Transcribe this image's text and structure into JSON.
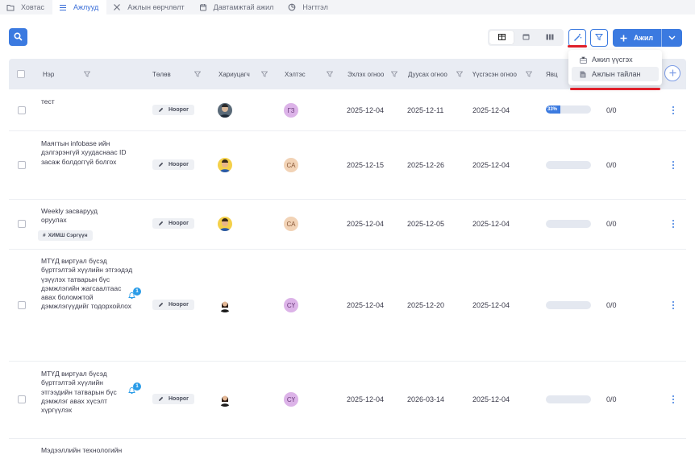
{
  "tabs": [
    {
      "label": "Ховтас",
      "icon": "folder-icon",
      "active": false
    },
    {
      "label": "Ажлууд",
      "icon": "list-icon",
      "active": true
    },
    {
      "label": "Ажлын өөрчлөлт",
      "icon": "tools-icon",
      "active": false
    },
    {
      "label": "Давтамжтай ажил",
      "icon": "calendar-icon",
      "active": false
    },
    {
      "label": "Нэгтгэл",
      "icon": "pie-chart-icon",
      "active": false
    }
  ],
  "toolbar": {
    "add_label": "Ажил"
  },
  "dropdown": {
    "items": [
      {
        "label": "Ажил үүсгэх",
        "icon": "briefcase-icon"
      },
      {
        "label": "Ажлын тайлан",
        "icon": "document-icon"
      }
    ]
  },
  "columns": {
    "name": "Нэр",
    "status": "Төлөв",
    "assignee": "Хариуцагч",
    "department": "Хэлтэс",
    "start_date": "Эхлэх огноо",
    "end_date": "Дуусах огноо",
    "created_date": "Үүсгэсэн огноо",
    "progress": "Явц"
  },
  "rows": [
    {
      "name": "тест",
      "status": "Ноорог",
      "dept": "ГЗ",
      "start": "2025-12-04",
      "end": "2025-12-11",
      "created": "2025-12-04",
      "progress_label": "33%",
      "progress": 0.33,
      "count": "0/0"
    },
    {
      "name": "Маягтын infobase ийн дэлгэрэнгүй хуудаснаас ID засаж болдоггүй болгох",
      "status": "Ноорог",
      "dept": "СА",
      "start": "2025-12-15",
      "end": "2025-12-26",
      "created": "2025-12-04",
      "progress": 0,
      "count": "0/0"
    },
    {
      "name": "Weekly засваруудоруулах",
      "name_line1": "Weekly засварууд",
      "name_line2": "оруулах",
      "tag": "ХИМШ Сэргүүн",
      "status": "Ноорог",
      "dept": "СА",
      "start": "2025-12-04",
      "end": "2025-12-05",
      "created": "2025-12-04",
      "progress": 0,
      "count": "0/0"
    },
    {
      "name": "МТҮД виртуал бүсэд бүртгэлтэй хүүлийн этгээдэд үзүүлэх татварын бүс дэмжлэгийн жагсаалтаас авах боломжтой дэмжлэгүүдийг тодорхойлох",
      "bell_badge": "1",
      "status": "Ноорог",
      "dept": "СҮ",
      "start": "2025-12-04",
      "end": "2025-12-20",
      "created": "2025-12-04",
      "progress": 0,
      "count": "0/0"
    },
    {
      "name": "МТҮД виртуал бүсэд бүртгэлтэй хүүлийн этгээдийн татварын бүс дэмжлэг авах хүсэлт хүргүүлэх",
      "bell_badge": "1",
      "status": "Ноорог",
      "dept": "СҮ",
      "start": "2025-12-04",
      "end": "2026-03-14",
      "created": "2025-12-04",
      "progress": 0,
      "count": "0/0"
    },
    {
      "name": "Мэдээллийн технологийн"
    }
  ],
  "colors": {
    "accent": "#3b7ae0",
    "highlight": "#e0202a"
  }
}
